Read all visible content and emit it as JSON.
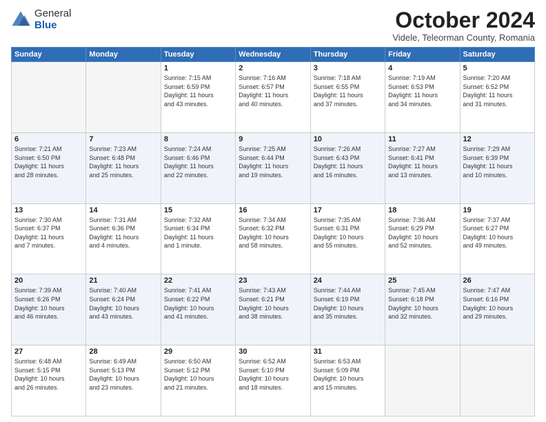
{
  "header": {
    "logo_general": "General",
    "logo_blue": "Blue",
    "month_title": "October 2024",
    "subtitle": "Videle, Teleorman County, Romania"
  },
  "days_of_week": [
    "Sunday",
    "Monday",
    "Tuesday",
    "Wednesday",
    "Thursday",
    "Friday",
    "Saturday"
  ],
  "weeks": [
    {
      "shaded": false,
      "days": [
        {
          "num": "",
          "info": ""
        },
        {
          "num": "",
          "info": ""
        },
        {
          "num": "1",
          "info": "Sunrise: 7:15 AM\nSunset: 6:59 PM\nDaylight: 11 hours\nand 43 minutes."
        },
        {
          "num": "2",
          "info": "Sunrise: 7:16 AM\nSunset: 6:57 PM\nDaylight: 11 hours\nand 40 minutes."
        },
        {
          "num": "3",
          "info": "Sunrise: 7:18 AM\nSunset: 6:55 PM\nDaylight: 11 hours\nand 37 minutes."
        },
        {
          "num": "4",
          "info": "Sunrise: 7:19 AM\nSunset: 6:53 PM\nDaylight: 11 hours\nand 34 minutes."
        },
        {
          "num": "5",
          "info": "Sunrise: 7:20 AM\nSunset: 6:52 PM\nDaylight: 11 hours\nand 31 minutes."
        }
      ]
    },
    {
      "shaded": true,
      "days": [
        {
          "num": "6",
          "info": "Sunrise: 7:21 AM\nSunset: 6:50 PM\nDaylight: 11 hours\nand 28 minutes."
        },
        {
          "num": "7",
          "info": "Sunrise: 7:23 AM\nSunset: 6:48 PM\nDaylight: 11 hours\nand 25 minutes."
        },
        {
          "num": "8",
          "info": "Sunrise: 7:24 AM\nSunset: 6:46 PM\nDaylight: 11 hours\nand 22 minutes."
        },
        {
          "num": "9",
          "info": "Sunrise: 7:25 AM\nSunset: 6:44 PM\nDaylight: 11 hours\nand 19 minutes."
        },
        {
          "num": "10",
          "info": "Sunrise: 7:26 AM\nSunset: 6:43 PM\nDaylight: 11 hours\nand 16 minutes."
        },
        {
          "num": "11",
          "info": "Sunrise: 7:27 AM\nSunset: 6:41 PM\nDaylight: 11 hours\nand 13 minutes."
        },
        {
          "num": "12",
          "info": "Sunrise: 7:29 AM\nSunset: 6:39 PM\nDaylight: 11 hours\nand 10 minutes."
        }
      ]
    },
    {
      "shaded": false,
      "days": [
        {
          "num": "13",
          "info": "Sunrise: 7:30 AM\nSunset: 6:37 PM\nDaylight: 11 hours\nand 7 minutes."
        },
        {
          "num": "14",
          "info": "Sunrise: 7:31 AM\nSunset: 6:36 PM\nDaylight: 11 hours\nand 4 minutes."
        },
        {
          "num": "15",
          "info": "Sunrise: 7:32 AM\nSunset: 6:34 PM\nDaylight: 11 hours\nand 1 minute."
        },
        {
          "num": "16",
          "info": "Sunrise: 7:34 AM\nSunset: 6:32 PM\nDaylight: 10 hours\nand 58 minutes."
        },
        {
          "num": "17",
          "info": "Sunrise: 7:35 AM\nSunset: 6:31 PM\nDaylight: 10 hours\nand 55 minutes."
        },
        {
          "num": "18",
          "info": "Sunrise: 7:36 AM\nSunset: 6:29 PM\nDaylight: 10 hours\nand 52 minutes."
        },
        {
          "num": "19",
          "info": "Sunrise: 7:37 AM\nSunset: 6:27 PM\nDaylight: 10 hours\nand 49 minutes."
        }
      ]
    },
    {
      "shaded": true,
      "days": [
        {
          "num": "20",
          "info": "Sunrise: 7:39 AM\nSunset: 6:26 PM\nDaylight: 10 hours\nand 46 minutes."
        },
        {
          "num": "21",
          "info": "Sunrise: 7:40 AM\nSunset: 6:24 PM\nDaylight: 10 hours\nand 43 minutes."
        },
        {
          "num": "22",
          "info": "Sunrise: 7:41 AM\nSunset: 6:22 PM\nDaylight: 10 hours\nand 41 minutes."
        },
        {
          "num": "23",
          "info": "Sunrise: 7:43 AM\nSunset: 6:21 PM\nDaylight: 10 hours\nand 38 minutes."
        },
        {
          "num": "24",
          "info": "Sunrise: 7:44 AM\nSunset: 6:19 PM\nDaylight: 10 hours\nand 35 minutes."
        },
        {
          "num": "25",
          "info": "Sunrise: 7:45 AM\nSunset: 6:18 PM\nDaylight: 10 hours\nand 32 minutes."
        },
        {
          "num": "26",
          "info": "Sunrise: 7:47 AM\nSunset: 6:16 PM\nDaylight: 10 hours\nand 29 minutes."
        }
      ]
    },
    {
      "shaded": false,
      "days": [
        {
          "num": "27",
          "info": "Sunrise: 6:48 AM\nSunset: 5:15 PM\nDaylight: 10 hours\nand 26 minutes."
        },
        {
          "num": "28",
          "info": "Sunrise: 6:49 AM\nSunset: 5:13 PM\nDaylight: 10 hours\nand 23 minutes."
        },
        {
          "num": "29",
          "info": "Sunrise: 6:50 AM\nSunset: 5:12 PM\nDaylight: 10 hours\nand 21 minutes."
        },
        {
          "num": "30",
          "info": "Sunrise: 6:52 AM\nSunset: 5:10 PM\nDaylight: 10 hours\nand 18 minutes."
        },
        {
          "num": "31",
          "info": "Sunrise: 6:53 AM\nSunset: 5:09 PM\nDaylight: 10 hours\nand 15 minutes."
        },
        {
          "num": "",
          "info": ""
        },
        {
          "num": "",
          "info": ""
        }
      ]
    }
  ]
}
